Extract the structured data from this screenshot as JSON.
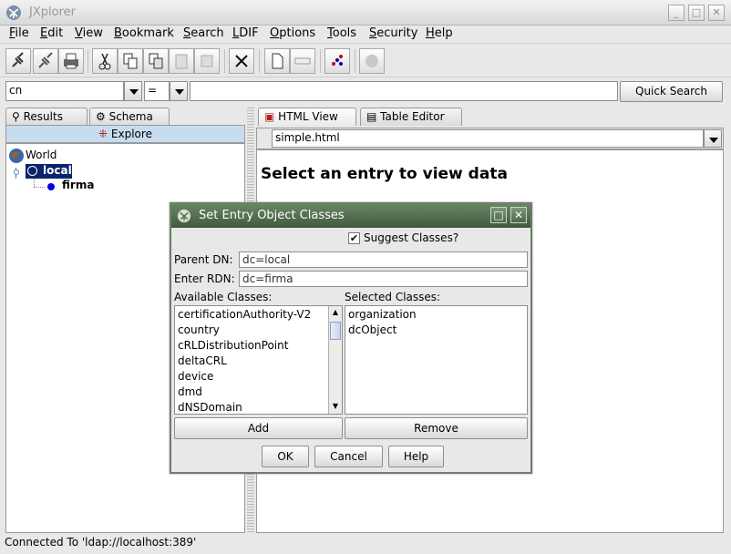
{
  "window": {
    "title": "JXplorer"
  },
  "menu": [
    "File",
    "Edit",
    "View",
    "Bookmark",
    "Search",
    "LDIF",
    "Options",
    "Tools",
    "Security",
    "Help"
  ],
  "search": {
    "attribute": "cn",
    "operator": "=",
    "value": "",
    "button": "Quick Search"
  },
  "left_tabs": {
    "results": "Results",
    "schema": "Schema",
    "explore": "Explore"
  },
  "tree": {
    "root": "World",
    "node": "local",
    "leaf": "firma"
  },
  "right_tabs": {
    "html_view": "HTML View",
    "table_editor": "Table Editor"
  },
  "file_combo": "simple.html",
  "html_content": "Select an entry to view data",
  "status": "Connected To 'ldap://localhost:389'",
  "dialog": {
    "title": "Set Entry Object Classes",
    "suggest_label": "Suggest Classes?",
    "suggest_checked": true,
    "parent_dn_label": "Parent DN:",
    "parent_dn_value": "dc=local",
    "rdn_label": "Enter RDN:",
    "rdn_value": "dc=firma",
    "available_label": "Available Classes:",
    "selected_label": "Selected Classes:",
    "available": [
      "certificationAuthority-V2",
      "country",
      "cRLDistributionPoint",
      "deltaCRL",
      "device",
      "dmd",
      "dNSDomain"
    ],
    "selected": [
      "organization",
      "dcObject"
    ],
    "add": "Add",
    "remove": "Remove",
    "ok": "OK",
    "cancel": "Cancel",
    "help": "Help"
  },
  "colors": {
    "dialog_title": "#4f6b4c",
    "selection": "#0a246a",
    "tree_bullet": "#0000e0"
  }
}
